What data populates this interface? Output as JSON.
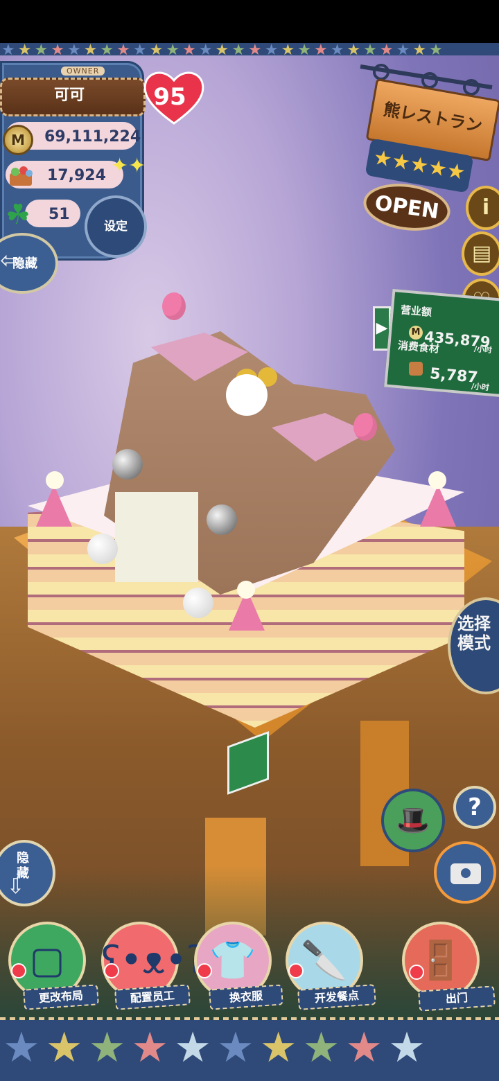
{
  "owner": {
    "tag": "OWNER",
    "name": "可可",
    "level": "95"
  },
  "currency": {
    "money_icon": "M",
    "money": "69,111,224",
    "food": "17,924",
    "clover": "51"
  },
  "buttons": {
    "settings": "设定",
    "hide_top": "隐藏",
    "hide_bottom": "隐藏",
    "mode": "选择模式",
    "help": "?"
  },
  "restaurant": {
    "name": "熊レストラン",
    "stars": 5,
    "status": "OPEN"
  },
  "side_icons": {
    "info": "i",
    "book": "book-icon",
    "heart": "heart-icon"
  },
  "sales": {
    "revenue_label": "营业额",
    "revenue_value": "435,879",
    "revenue_unit": "/小时",
    "consumption_label": "消费食材",
    "consumption_value": "5,787",
    "consumption_unit": "/小时"
  },
  "actions": [
    {
      "label": "更改布局",
      "icon": "table-icon"
    },
    {
      "label": "配置员工",
      "icon": "bear-icon"
    },
    {
      "label": "换衣服",
      "icon": "shirt-icon"
    },
    {
      "label": "开发餐点",
      "icon": "knife-icon"
    },
    {
      "label": "出门",
      "icon": "door-icon"
    }
  ],
  "colors": {
    "accent": "#2e4a78",
    "pin": "#ef3b4a",
    "board": "#1f6b3e",
    "heart": "#e8334a"
  }
}
